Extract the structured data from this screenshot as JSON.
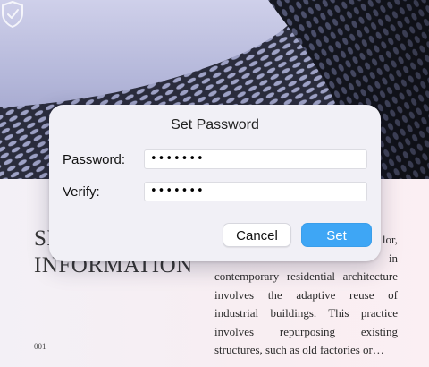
{
  "dialog": {
    "title": "Set Password",
    "password_label": "Password:",
    "password_value": "•••••••",
    "verify_label": "Verify:",
    "verify_value": "•••••••",
    "cancel_label": "Cancel",
    "set_label": "Set"
  },
  "document": {
    "title_line1": "SE",
    "title_line2": "INFORMATION",
    "page_number": "001",
    "body_lines": [
      "lor,",
      "in",
      "contemporary residential architecture",
      "involves the adaptive reuse of",
      "industrial buildings. This practice",
      "involves repurposing existing",
      "structures, such as old factories or…"
    ]
  },
  "icons": {
    "shield": "shield-check-icon"
  },
  "colors": {
    "accent": "#3ea6f5",
    "dialog_bg": "#f1f0f6"
  }
}
